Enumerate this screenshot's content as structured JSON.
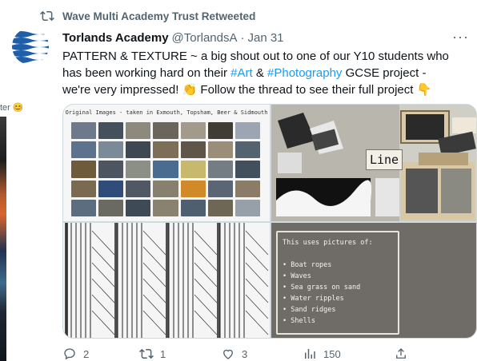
{
  "left_edge": {
    "peek_text": "ter",
    "emoji": "😊"
  },
  "retweet": {
    "icon": "retweet-icon",
    "text": "Wave Multi Academy Trust Retweeted"
  },
  "tweet": {
    "author_name": "Torlands Academy",
    "handle": "@TorlandsA",
    "separator": "·",
    "date": "Jan 31",
    "more": "···",
    "text_line1": "PATTERN & TEXTURE ~ a big shout out to one of our Y10 students who",
    "text_line2_pre": "has been working hard on their ",
    "hashtag_art": "#Art",
    "text_amp": " & ",
    "hashtag_photo": "#Photography",
    "text_line2_post": " GCSE project -",
    "text_line3_pre": "we're very impressed! ",
    "emoji_clap": "👏",
    "text_line3_mid": " Follow the thread to see their full project ",
    "emoji_point": "👇"
  },
  "media": {
    "tile1_caption": "Original Images - taken in Exmouth, Topsham, Beer & Sidmouth",
    "tile2_label": "Line",
    "tile4_title": "This uses pictures of:",
    "tile4_items": [
      "• Boat ropes",
      "• Waves",
      "• Sea grass on sand",
      "• Water ripples",
      "• Sand ridges",
      "• Shells"
    ]
  },
  "actions": {
    "reply_count": "2",
    "retweet_count": "1",
    "like_count": "3",
    "views_count": "150"
  },
  "colors": {
    "link": "#1d9bf0",
    "muted": "#536471",
    "text": "#0f1419"
  }
}
